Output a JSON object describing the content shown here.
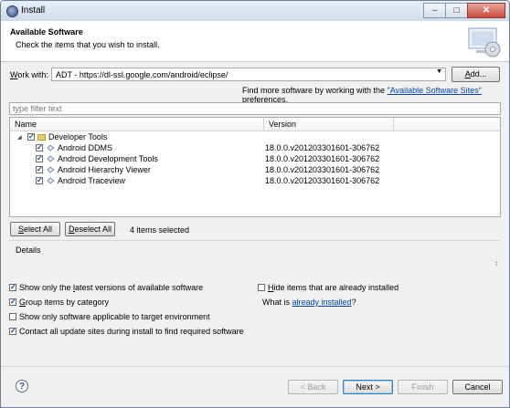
{
  "window": {
    "title": "Install"
  },
  "banner": {
    "title": "Available Software",
    "description": "Check the items that you wish to install."
  },
  "work_with": {
    "label_pre": "W",
    "label_post": "ork with:",
    "value": "ADT - https://dl-ssl.google.com/android/eclipse/",
    "add_pre": "A",
    "add_post": "dd..."
  },
  "find_more": {
    "prefix": "Find more software by working with the ",
    "link": "\"Available Software Sites\"",
    "suffix": " preferences."
  },
  "filter": {
    "placeholder": "type filter text"
  },
  "tree": {
    "columns": {
      "name": "Name",
      "version": "Version"
    },
    "category": "Developer Tools",
    "items": [
      {
        "name": "Android DDMS",
        "version": "18.0.0.v201203301601-306762"
      },
      {
        "name": "Android Development Tools",
        "version": "18.0.0.v201203301601-306762"
      },
      {
        "name": "Android Hierarchy Viewer",
        "version": "18.0.0.v201203301601-306762"
      },
      {
        "name": "Android Traceview",
        "version": "18.0.0.v201203301601-306762"
      }
    ]
  },
  "selection": {
    "select_all_pre": "S",
    "select_all_post": "elect All",
    "deselect_all_pre": "D",
    "deselect_all_post": "eselect All",
    "count": "4 items selected"
  },
  "details": {
    "label": "Details",
    "scroll_glyph": "↕"
  },
  "options": {
    "latest_pre": "Show only the ",
    "latest_accel": "l",
    "latest_post": "atest versions of available software",
    "group_pre": "",
    "group_accel": "G",
    "group_post": "roup items by category",
    "applicable": "Show only software applicable to target environment",
    "contact": "Contact all update sites during install to find required software",
    "hide_pre": "",
    "hide_accel": "H",
    "hide_post": "ide items that are already installed",
    "what_is": "What is ",
    "already_installed": "already installed",
    "qmark": "?"
  },
  "buttons": {
    "back": "< Back",
    "next": "Next >",
    "finish": "Finish",
    "cancel": "Cancel"
  },
  "help": "?"
}
